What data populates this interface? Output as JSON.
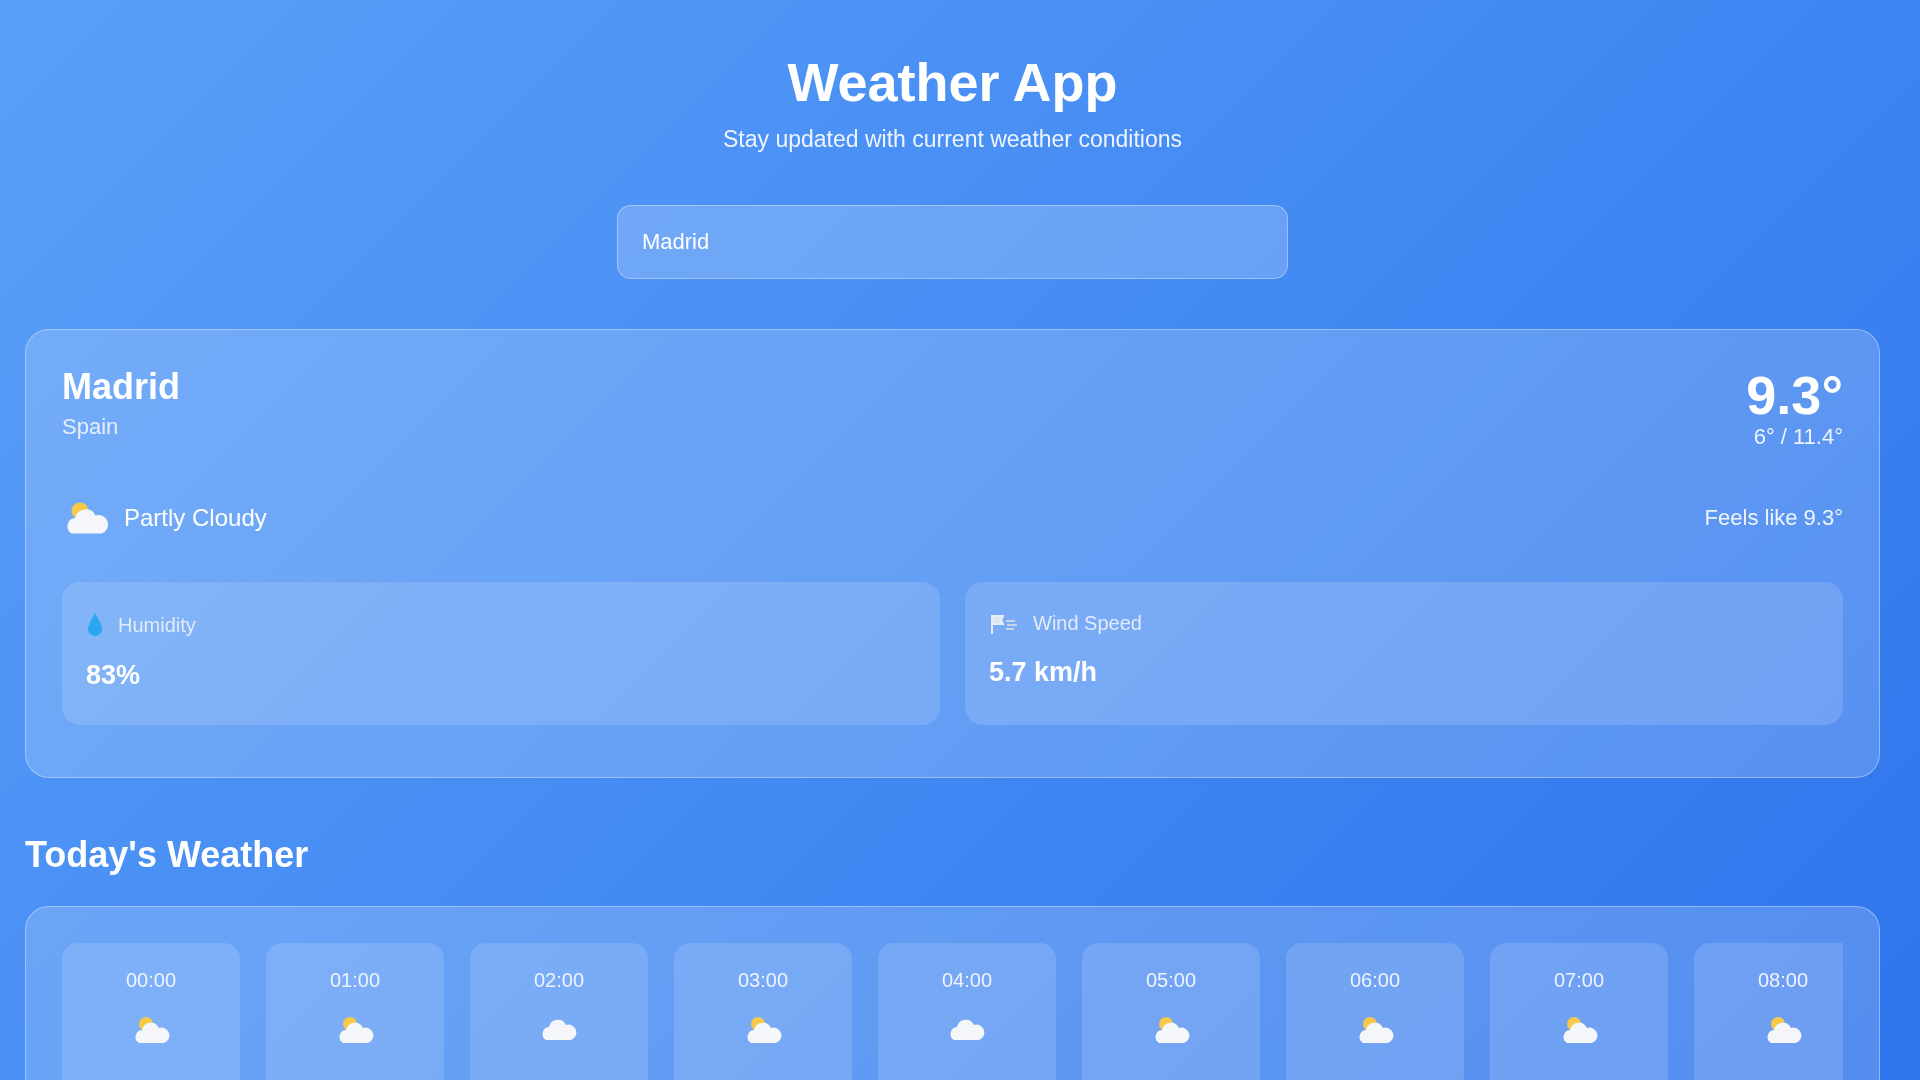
{
  "header": {
    "title": "Weather App",
    "subtitle": "Stay updated with current weather conditions"
  },
  "search": {
    "value": "Madrid"
  },
  "current": {
    "city": "Madrid",
    "country": "Spain",
    "temperature": "9.3°",
    "range": "6° / 11.4°",
    "condition": "Partly Cloudy",
    "condition_icon": {
      "kind": "partly"
    },
    "feels_like": "Feels like 9.3°",
    "stats": [
      {
        "kind": "humidity",
        "label": "Humidity",
        "value": "83%"
      },
      {
        "kind": "wind",
        "label": "Wind Speed",
        "value": "5.7 km/h"
      }
    ]
  },
  "today": {
    "title": "Today's Weather",
    "hours": [
      {
        "time": "00:00",
        "kind": "partly"
      },
      {
        "time": "01:00",
        "kind": "partly"
      },
      {
        "time": "02:00",
        "kind": "cloud"
      },
      {
        "time": "03:00",
        "kind": "partly"
      },
      {
        "time": "04:00",
        "kind": "cloud"
      },
      {
        "time": "05:00",
        "kind": "partly"
      },
      {
        "time": "06:00",
        "kind": "partly"
      },
      {
        "time": "07:00",
        "kind": "partly"
      },
      {
        "time": "08:00",
        "kind": "partly"
      }
    ]
  }
}
